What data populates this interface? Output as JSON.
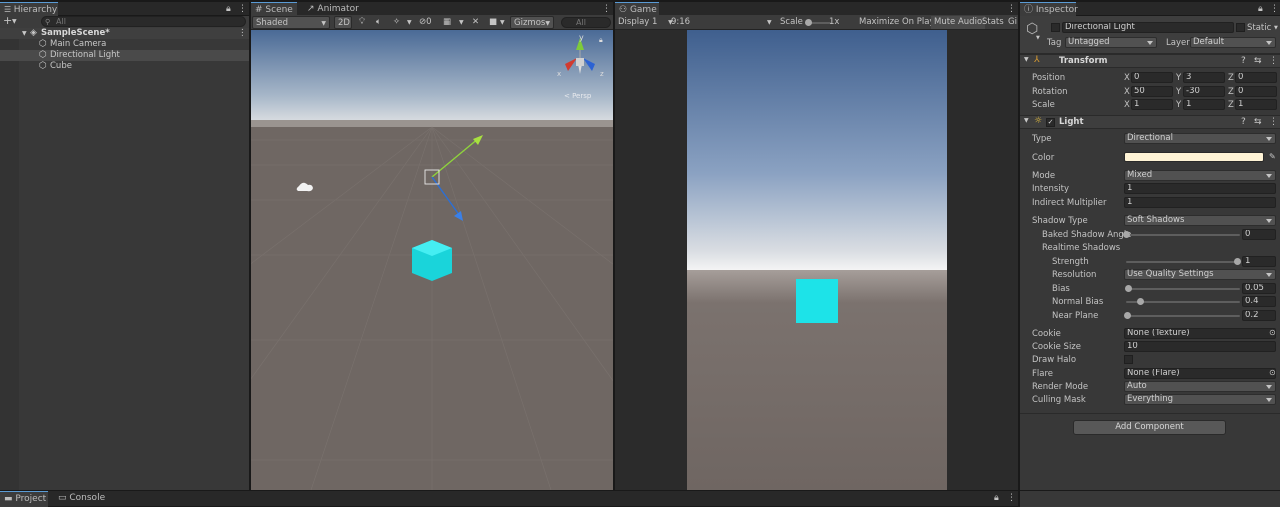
{
  "hierarchy": {
    "tab": "Hierarchy",
    "search_placeholder": "All",
    "scene": "SampleScene*",
    "items": [
      "Main Camera",
      "Directional Light",
      "Cube"
    ]
  },
  "scene_view": {
    "tabs": [
      "Scene",
      "Animator"
    ],
    "shading": "Shaded",
    "mode_2d": "2D",
    "hidden_count": "0",
    "gizmos": "Gizmos",
    "search_placeholder": "All",
    "persp_label": "< Persp"
  },
  "game_view": {
    "tab": "Game",
    "display": "Display 1",
    "aspect": "9:16",
    "scale_label": "Scale",
    "scale_value": "1x",
    "maximize": "Maximize On Play",
    "mute": "Mute Audio",
    "stats": "Stats",
    "gizmos": "Gi"
  },
  "inspector": {
    "tab": "Inspector",
    "object_name": "Directional Light",
    "static_label": "Static",
    "tag_label": "Tag",
    "tag_value": "Untagged",
    "layer_label": "Layer",
    "layer_value": "Default",
    "transform": {
      "title": "Transform",
      "position_label": "Position",
      "rotation_label": "Rotation",
      "scale_label": "Scale",
      "position": {
        "x": "0",
        "y": "3",
        "z": "0"
      },
      "rotation": {
        "x": "50",
        "y": "-30",
        "z": "0"
      },
      "scale": {
        "x": "1",
        "y": "1",
        "z": "1"
      }
    },
    "light": {
      "title": "Light",
      "type_label": "Type",
      "type_value": "Directional",
      "color_label": "Color",
      "color_value": "#fff4d6",
      "mode_label": "Mode",
      "mode_value": "Mixed",
      "intensity_label": "Intensity",
      "intensity_value": "1",
      "indirect_label": "Indirect Multiplier",
      "indirect_value": "1",
      "shadow_type_label": "Shadow Type",
      "shadow_type_value": "Soft Shadows",
      "baked_angle_label": "Baked Shadow Angle",
      "baked_angle_value": "0",
      "realtime_label": "Realtime Shadows",
      "strength_label": "Strength",
      "strength_value": "1",
      "resolution_label": "Resolution",
      "resolution_value": "Use Quality Settings",
      "bias_label": "Bias",
      "bias_value": "0.05",
      "normal_bias_label": "Normal Bias",
      "normal_bias_value": "0.4",
      "near_plane_label": "Near Plane",
      "near_plane_value": "0.2",
      "cookie_label": "Cookie",
      "cookie_value": "None (Texture)",
      "cookie_size_label": "Cookie Size",
      "cookie_size_value": "10",
      "draw_halo_label": "Draw Halo",
      "flare_label": "Flare",
      "flare_value": "None (Flare)",
      "render_mode_label": "Render Mode",
      "render_mode_value": "Auto",
      "culling_label": "Culling Mask",
      "culling_value": "Everything"
    },
    "add_component": "Add Component"
  },
  "bottom": {
    "tabs": [
      "Project",
      "Console"
    ]
  },
  "colors": {
    "cube": "#1de3e8",
    "accent": "#5a9bd5"
  }
}
